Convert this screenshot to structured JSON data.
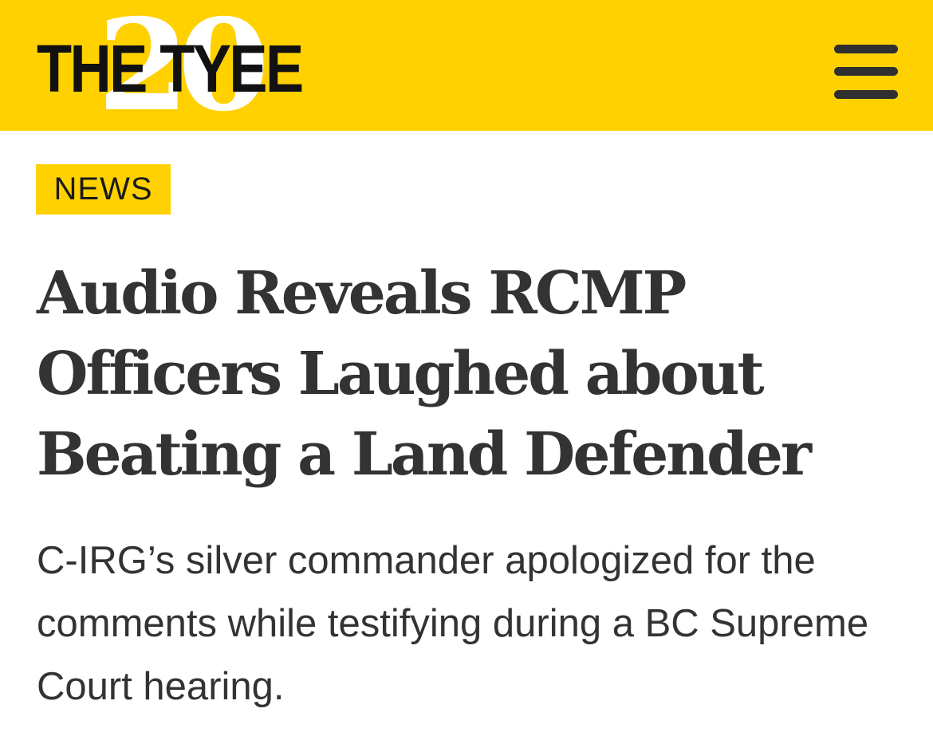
{
  "header": {
    "logo_text": "THE TYEE",
    "logo_anniversary": "20",
    "background_color": "#ffd100",
    "menu_icon": "hamburger-menu-icon"
  },
  "article": {
    "category": "NEWS",
    "headline": "Audio Reveals RCMP Officers Laughed about Beating a Land Defender",
    "dek": "C-IRG’s silver commander apologized for the comments while testifying during a BC Supreme Court hearing."
  }
}
